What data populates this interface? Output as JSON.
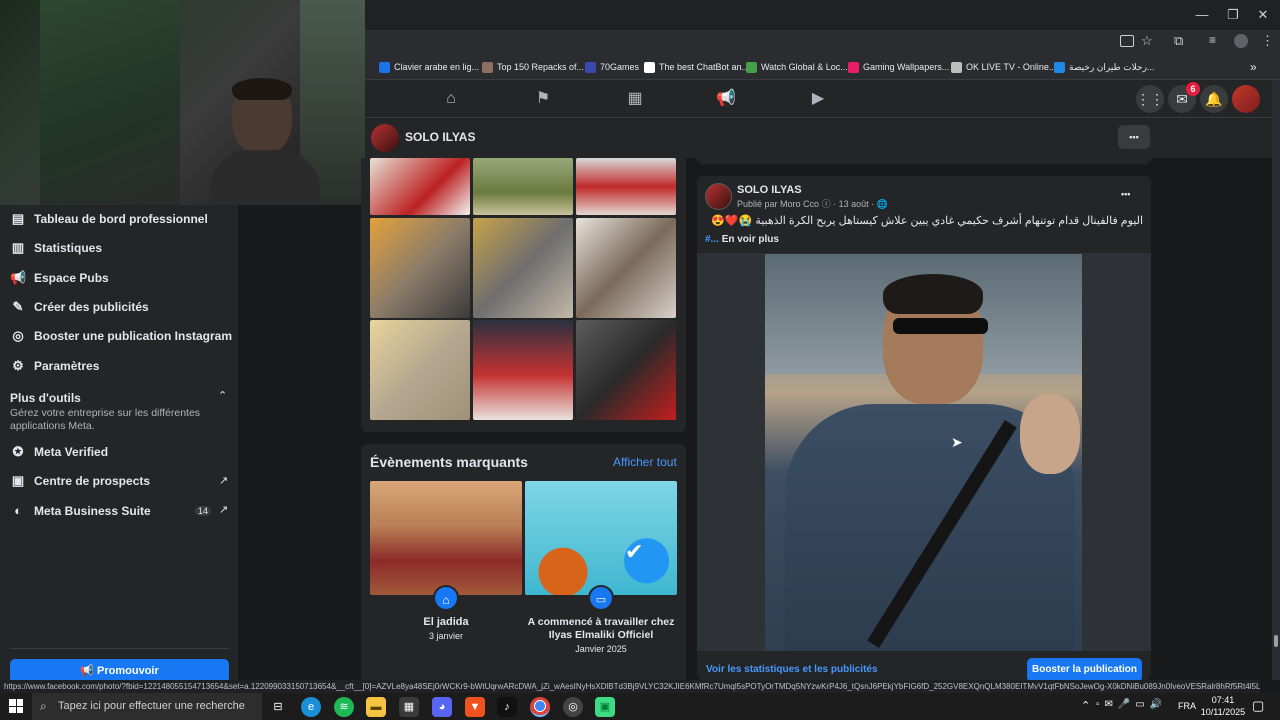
{
  "browser": {
    "bookmarks": [
      {
        "label": "Clavier arabe en lig...",
        "color": "#1a73e8"
      },
      {
        "label": "Top 150 Repacks of...",
        "color": "#8d6e63"
      },
      {
        "label": "70Games",
        "color": "#3949ab"
      },
      {
        "label": "The best ChatBot an...",
        "color": "#ffffff"
      },
      {
        "label": "Watch Global & Loc...",
        "color": "#43a047"
      },
      {
        "label": "Gaming Wallpapers...",
        "color": "#e91e63"
      },
      {
        "label": "OK LIVE TV - Online...",
        "color": "#bdbdbd"
      },
      {
        "label": "رحلات طيران رخيصة...",
        "color": "#1e88e5"
      }
    ],
    "more_bookmarks": "»",
    "window_controls": {
      "minimize": "—",
      "maximize": "❐",
      "close": "✕"
    }
  },
  "fbnav": {
    "messenger_badge": "6"
  },
  "page_header": {
    "name": "SOLO ILYAS",
    "more": "•••"
  },
  "sidebar": {
    "items": [
      {
        "label": "Tableau de bord professionnel",
        "icon": "dashboard-icon"
      },
      {
        "label": "Statistiques",
        "icon": "stats-icon"
      },
      {
        "label": "Espace Pubs",
        "icon": "megaphone-icon"
      },
      {
        "label": "Créer des publicités",
        "icon": "pencil-icon"
      },
      {
        "label": "Booster une publication Instagram",
        "icon": "instagram-icon"
      },
      {
        "label": "Paramètres",
        "icon": "gear-icon"
      }
    ],
    "more_tools_title": "Plus d'outils",
    "more_tools_desc": "Gérez votre entreprise sur les différentes applications Meta.",
    "tools": [
      {
        "label": "Meta Verified",
        "icon": "verified-icon"
      },
      {
        "label": "Centre de prospects",
        "icon": "prospects-icon"
      },
      {
        "label": "Meta Business Suite",
        "icon": "business-suite-icon",
        "badge": "14"
      }
    ],
    "promote": "Promouvoir"
  },
  "highlights": {
    "title": "Évènements marquants",
    "see_all": "Afficher tout",
    "items": [
      {
        "title": "El jadida",
        "date": "3 janvier"
      },
      {
        "title": "A commencé à travailler chez Ilyas Elmaliki Officiel",
        "date": "Janvier 2025"
      }
    ]
  },
  "post": {
    "author": "SOLO ILYAS",
    "published_by": "Publié par Moro Cco",
    "date": "13 août",
    "text": "اليوم فالفينال قدام توتنهام أشرف حكيمي غادي يبين علاش كيستاهل يربح الكرة الذهبية 😭❤️😍",
    "hashtag": "#...",
    "see_more": "En voir plus",
    "stats_link": "Voir les statistiques et les publicités",
    "boost": "Booster la publication",
    "more": "•••"
  },
  "status_url": "https://www.facebook.com/photo/?fbid=122148055154713654&set=a.122099033150713654&__cft__[0]=AZVLe8ya48SEj0rWCKr9-bWtUqrwARcDWA_jZi_wAesINyHsXDlBTd3Bj9VLYC32KJIE6KMfRc7Umql5sPOTyOrTMDq5NYzwKrP4J6_tQsnJ6PEkjYbFIG6fD_252GV8EXQnQLM380EITMvV1qtFbNSoJewOg-X0kDNiBu089Jn0IveoVESRalr8hRf5Rt4l5Ljkxt C96wBiT...",
  "taskbar": {
    "search_placeholder": "Tapez ici pour effectuer une recherche",
    "language": "FRA",
    "time": "07:41",
    "date": "10/11/2025"
  }
}
